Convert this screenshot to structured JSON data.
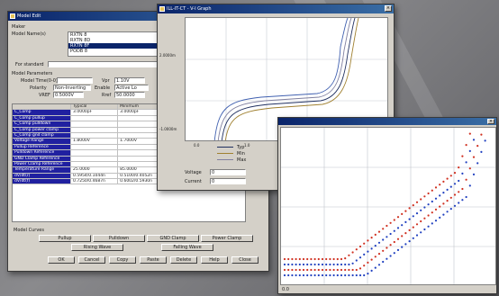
{
  "model_edit": {
    "title": "Model Edit",
    "maker_label": "Maker",
    "model_name_label": "Model Name(s)",
    "models": [
      "RXTN 8",
      "RXTN 8D",
      "RXTN 8F",
      "PODB 8"
    ],
    "selected_model_index": 2,
    "for_standard_label": "For standard",
    "model_params_label": "Model Parameters",
    "model_time_label": "Model Time(0-0)",
    "model_time_value": "",
    "vpr_label": "Vpr",
    "vpr_value": "1.10V",
    "polarity_label": "Polarity",
    "polarity_value": "Non-Inverting",
    "enable_label": "Enable",
    "enable_value": "Active Lo",
    "vref_label": "VREF",
    "vref_value": "0.5000V",
    "rref_label": "Rref",
    "rref_value": "50.0000",
    "table_headers": [
      "",
      "Typical",
      "Minimum",
      "",
      ""
    ],
    "table_rows": [
      [
        "C_Comp",
        "3.0000pF",
        "3.0000pF",
        "",
        ""
      ],
      [
        "C_Comp pullup",
        "",
        "",
        "",
        ""
      ],
      [
        "C_Comp pulldown",
        "",
        "",
        "",
        ""
      ],
      [
        "C_Comp power clamp",
        "",
        "",
        "",
        ""
      ],
      [
        "C_Comp gnd clamp",
        "",
        "",
        "",
        ""
      ],
      [
        "Voltage Range",
        "1.8000V",
        "1.7000V",
        "",
        ""
      ],
      [
        "Pullup Reference",
        "",
        "",
        "",
        ""
      ],
      [
        "Pulldown Reference",
        "",
        "",
        "",
        ""
      ],
      [
        "GND Clamp Reference",
        "",
        "",
        "",
        ""
      ],
      [
        "Power Clamp Reference",
        "",
        "",
        "",
        ""
      ],
      [
        "Temperature Range",
        "25.0000",
        "85.0000",
        "0.0000",
        ""
      ],
      [
        "dV/dt(r)",
        "0.5954/0.1044n",
        "0.5100/0.4052n",
        "0.6808/0.2155n",
        ""
      ],
      [
        "dV/dt(f)",
        "0.7250/0.4687n",
        "0.6002/0.5930n",
        "0.6877/0.2255n",
        ""
      ]
    ],
    "model_curves_label": "Model Curves",
    "curve_buttons_row1": [
      "Pullup",
      "Pulldown",
      "GND Clamp",
      "Power Clamp"
    ],
    "curve_buttons_row2": [
      "Rising Wave",
      "Falling Wave"
    ],
    "bottom_buttons": [
      "OK",
      "Cancel",
      "Copy",
      "Paste",
      "Delete",
      "Help",
      "Close"
    ]
  },
  "vi_graph": {
    "title": "ILL-IT-CT - V-I Graph",
    "y_ticks": [
      "2.0000m",
      "",
      "-1.0000m"
    ],
    "x_ticks": [
      "0.0",
      "1.0",
      "2.0",
      "3.0"
    ],
    "legend": [
      "Typ",
      "Min",
      "Max"
    ],
    "field1_label": "Voltage",
    "field1_value": "0",
    "field2_label": "Current",
    "field2_value": "0"
  },
  "scatter_window": {
    "status": "0.0"
  },
  "colors": {
    "title_bar_start": "#0a246a",
    "title_bar_end": "#3a6ea5",
    "series_red": "#d03020",
    "series_blue": "#2040c0",
    "series_dark": "#203060"
  }
}
